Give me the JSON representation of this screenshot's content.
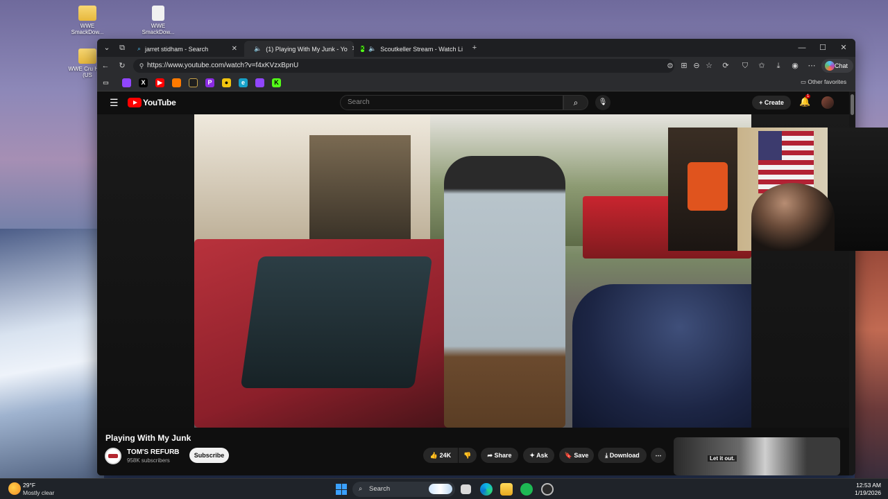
{
  "desktop": {
    "icons": [
      {
        "label": "WWE SmackDow...",
        "kind": "folder"
      },
      {
        "label": "WWE SmackDow...",
        "kind": "file"
      },
      {
        "label": "WWE Cru Hour (US",
        "kind": "folder"
      }
    ]
  },
  "browser": {
    "tabs": [
      {
        "label": "jarret stidham - Search",
        "active": false
      },
      {
        "label": "(1) Playing With My Junk - Yo",
        "active": true
      },
      {
        "label": "Scoutkeller Stream - Watch Li",
        "active": false
      }
    ],
    "url": "https://www.youtube.com/watch?v=f4xKVzxBpnU",
    "chat_label": "Chat",
    "other_favorites": "Other favorites",
    "favorites_icons": [
      "twitch-icon",
      "x-icon",
      "youtube-icon",
      "stats-icon",
      "app-icon",
      "patreon-icon",
      "github-icon",
      "edge-icon",
      "twitch-alt-icon",
      "kick-icon"
    ]
  },
  "youtube": {
    "logo_text": "YouTube",
    "search_placeholder": "Search",
    "create_label": "Create",
    "notification_count": "1",
    "video_title": "Playing With My Junk",
    "channel_name": "TOM'S REFURB",
    "subscribers": "958K subscribers",
    "subscribe_label": "Subscribe",
    "like_count": "24K",
    "share_label": "Share",
    "ask_label": "Ask",
    "save_label": "Save",
    "download_label": "Download",
    "recommended_caption": "Let it out."
  },
  "taskbar": {
    "temperature": "29°F",
    "condition": "Mostly clear",
    "search_label": "Search",
    "time": "12:53 AM",
    "date": "1/19/2026"
  },
  "colors": {
    "youtube_red": "#ff0000",
    "youtube_bg": "#0f0f0f",
    "browser_chrome": "#2b2c2f"
  }
}
